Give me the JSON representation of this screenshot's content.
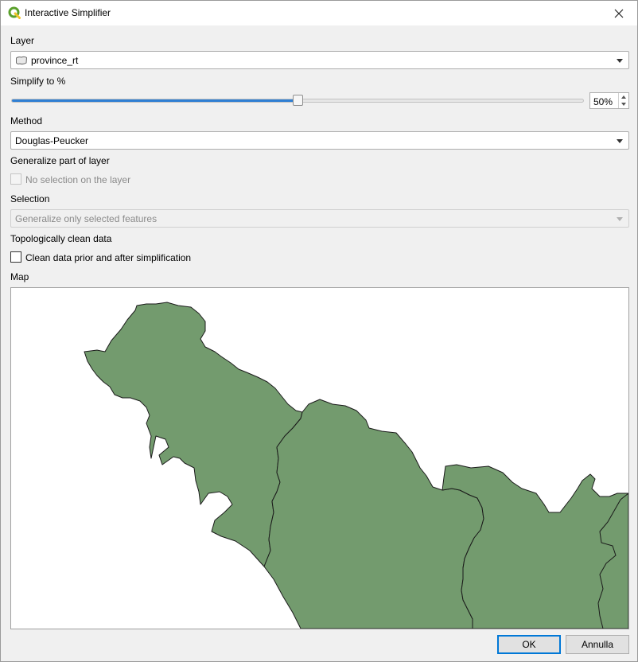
{
  "window": {
    "title": "Interactive Simplifier",
    "icon": "qgis-icon",
    "close_icon": "close-icon"
  },
  "layer": {
    "label": "Layer",
    "selected": "province_rt",
    "icon": "polygon-layer-icon"
  },
  "simplify": {
    "label": "Simplify to %",
    "percent": 50,
    "display": "50%"
  },
  "method": {
    "label": "Method",
    "selected": "Douglas-Peucker"
  },
  "generalize": {
    "label": "Generalize part of layer",
    "checkbox_label": "No selection on the layer",
    "checked": false,
    "enabled": false
  },
  "selection": {
    "label": "Selection",
    "selected": "Generalize only selected features",
    "enabled": false
  },
  "topology": {
    "label": "Topologically clean data",
    "checkbox_label": "Clean data prior and after simplification",
    "checked": false
  },
  "map": {
    "label": "Map",
    "fill_color": "#739b6e",
    "stroke_color": "#1a1a1a"
  },
  "buttons": {
    "ok": "OK",
    "cancel": "Annulla"
  },
  "colors": {
    "accent": "#2f7fd3",
    "default_button_border": "#0078d7"
  }
}
